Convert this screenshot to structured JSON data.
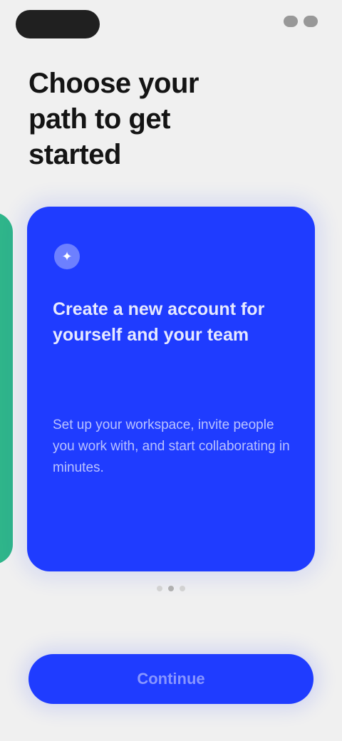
{
  "header": {
    "brand": "",
    "headline": "Choose your path to get started"
  },
  "carousel": {
    "active_index": 1,
    "total": 3,
    "cards": [
      {
        "color": "#2fb58a"
      },
      {
        "color": "#1f3cff",
        "icon": "sparkle-icon",
        "title": "Create a new account for yourself and your team",
        "body": "Set up your workspace, invite people you work with, and start collaborating in minutes."
      }
    ]
  },
  "cta": {
    "label": "Continue"
  },
  "colors": {
    "background": "#f0f0f0",
    "accent": "#1f3cff",
    "secondary": "#2fb58a",
    "text": "#141414"
  }
}
